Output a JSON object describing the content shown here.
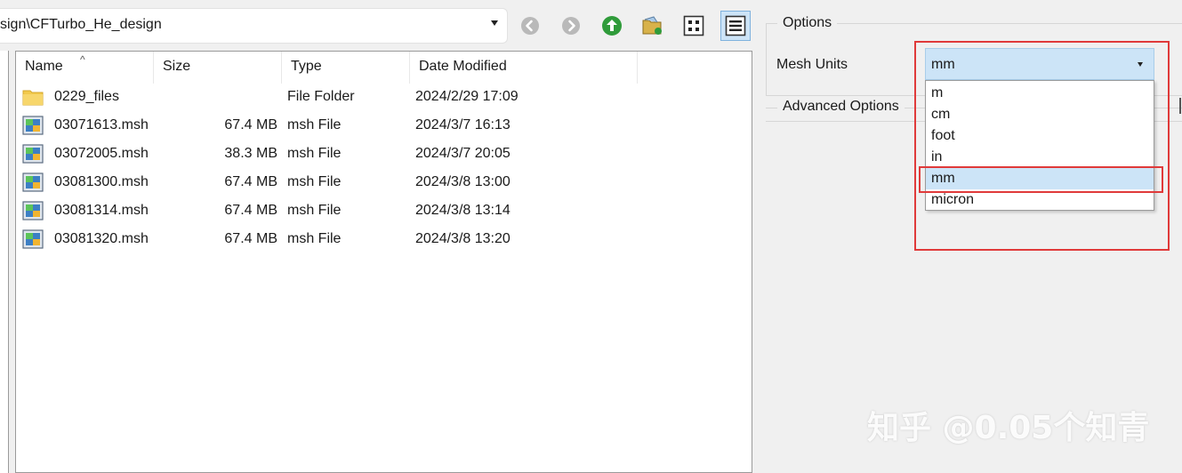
{
  "toolbar": {
    "path": "sign\\CFTurbo_He_design",
    "buttons": [
      "back-icon",
      "forward-icon",
      "up-folder-icon",
      "new-folder-icon",
      "icon-view-icon",
      "detail-view-icon"
    ]
  },
  "file_list": {
    "columns": [
      "Name",
      "Size",
      "Type",
      "Date Modified"
    ],
    "rows": [
      {
        "name": "0229_files",
        "size": "",
        "type": "File Folder",
        "date": "2024/2/29 17:09",
        "icon": "folder-icon"
      },
      {
        "name": "03071613.msh",
        "size": "67.4 MB",
        "type": "msh File",
        "date": "2024/3/7 16:13",
        "icon": "msh-file-icon"
      },
      {
        "name": "03072005.msh",
        "size": "38.3 MB",
        "type": "msh File",
        "date": "2024/3/7 20:05",
        "icon": "msh-file-icon"
      },
      {
        "name": "03081300.msh",
        "size": "67.4 MB",
        "type": "msh File",
        "date": "2024/3/8 13:00",
        "icon": "msh-file-icon"
      },
      {
        "name": "03081314.msh",
        "size": "67.4 MB",
        "type": "msh File",
        "date": "2024/3/8 13:14",
        "icon": "msh-file-icon"
      },
      {
        "name": "03081320.msh",
        "size": "67.4 MB",
        "type": "msh File",
        "date": "2024/3/8 13:20",
        "icon": "msh-file-icon"
      }
    ]
  },
  "options": {
    "group_label": "Options",
    "mesh_units_label": "Mesh Units",
    "mesh_units_value": "mm",
    "advanced_label": "Advanced Options",
    "dropdown_items": [
      "m",
      "cm",
      "foot",
      "in",
      "mm",
      "micron"
    ],
    "selected_index": 4
  },
  "watermark": "知乎 @0.05个知青",
  "colors": {
    "highlight": "#cce4f7",
    "annotation_red": "#e03a3a"
  }
}
